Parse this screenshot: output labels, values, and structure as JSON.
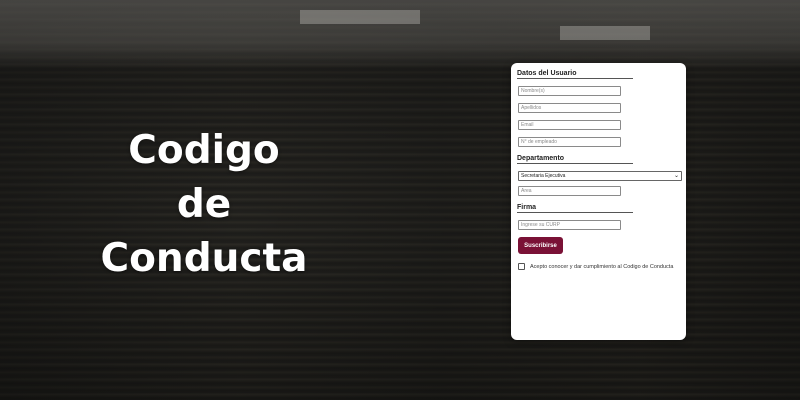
{
  "headline": {
    "line1": "Codigo",
    "line2": "de",
    "line3": "Conducta"
  },
  "form": {
    "user_section": {
      "title": "Datos del Usuario",
      "name_placeholder": "Nombre(s)",
      "lastname_placeholder": "Apellidos",
      "email_placeholder": "Email",
      "employee_placeholder": "N° de empleado"
    },
    "department_section": {
      "title": "Departamento",
      "selected": "Secretaria Ejecutiva",
      "area_placeholder": "Area"
    },
    "signature_section": {
      "title": "Firma",
      "curp_placeholder": "Ingrese su CURP"
    },
    "submit_label": "Suscribirse",
    "consent_label": "Acepto conocer y dar cumplimiento al Codigo de Conducta"
  },
  "colors": {
    "accent": "#7a1136",
    "card": "#ffffff"
  }
}
